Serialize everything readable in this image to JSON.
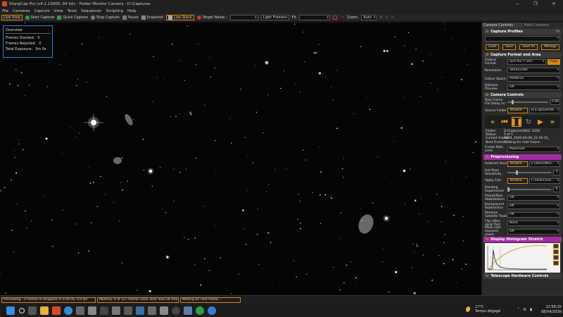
{
  "window": {
    "title": "SharpCap Pro (v4.1.13000, 64 bit) - Folder Monitor Camera - D:\\Captures",
    "controls": [
      "—",
      "❐",
      "✕"
    ]
  },
  "menu": [
    "File",
    "Cameras",
    "Capture",
    "View",
    "Tools",
    "Sequencer",
    "Scripting",
    "Help"
  ],
  "toolbar": {
    "live_view": "Live View",
    "start_capture": "Start Capture",
    "quick_capture": "Quick Capture",
    "stop_capture": "Stop Capture",
    "pause": "Pause",
    "snapshot": "Snapshot",
    "live_stack": "Live Stack",
    "target_name_label": "Target Name :",
    "target_name_value": "",
    "frame_type": "Light Frames",
    "fx_label": "FX",
    "fx_value": "",
    "zoom_label": "Zoom:",
    "zoom_value": "Auto"
  },
  "overview": {
    "title": "Overview",
    "frames_stacked_label": "Frames Stacked:",
    "frames_stacked": "5",
    "frames_rejected_label": "Frames Rejected:",
    "frames_rejected": "0",
    "total_exposure_label": "Total Exposure:",
    "total_exposure": "5m 0s"
  },
  "panel": {
    "tab_active": "Camera Controls",
    "tab_inactive": "Multi Columns",
    "capture_profiles": {
      "title": "Capture Profiles",
      "load": "Load",
      "save": "Save",
      "save_as": "Save As",
      "manage": "Manage"
    },
    "format": {
      "title": "Capture Format and Area",
      "output_format_label": "Output Format",
      "output_format": "SER file (*.ser)",
      "auto": "Auto",
      "resolution_label": "Resolution",
      "resolution": "3856x2180",
      "colour_space_label": "Colour Space",
      "colour_space": "MONO16",
      "debayer_label": "Debayer Preview",
      "debayer": "Off"
    },
    "camera": {
      "title": "Camera Controls",
      "new_frame_label": "New Frame File Delay (s)",
      "new_frame_value": "5.00",
      "source_folder_label": "Source Folder",
      "browse": "Browse...",
      "source_folder": "D:\\Captures\\N...",
      "folder_label": "Folder:",
      "folder": "D:\\Captures\\NGC 3350",
      "status_label": "Status:",
      "status": "5 of 5",
      "current_frame_label": "Current Frame:",
      "current_frame": "0004_2026-04-08_22-56-13_",
      "next_frame_label": "Next Frame:",
      "next_frame": "Waiting for next frame...",
      "frame_rate_label": "Frame Rate Limit",
      "frame_rate": "Maximum"
    },
    "preprocessing": {
      "title": "Preprocessing",
      "subtract_dark_label": "Subtract Dark",
      "browse": "Browse...",
      "subtract_dark": "E:\\darks\\Mini...",
      "hot_pixel_label": "Hot Pixel Sensitivity",
      "hot_pixel": "3",
      "apply_flat_label": "Apply Flat",
      "apply_flat": "C:\\Users\\Trai...",
      "banding_label": "Banding Suppression",
      "banding": "0",
      "planet_label": "Planet/Disk Stabilization",
      "planet": "Off",
      "background_label": "Background Subtraction",
      "background": "Off",
      "satellite_label": "Remove Satellite Trails",
      "satellite": "Off",
      "flip_label": "Flip (after dark/ flat)",
      "flip": "None",
      "mask_label": "Mask over exposed pixels",
      "mask": "Off"
    },
    "histogram": {
      "title": "Display Histogram Stretch"
    },
    "telescope": {
      "title": "Telescope Hardware Controls"
    }
  },
  "status": {
    "previewing": "Previewing : 5 frames (0 dropped) in 0:04:56, 0.0 fps",
    "memory": "Memory: 4 of 127 frames used, Disk: 834 GB free",
    "waiting": "Waiting for next frame..."
  },
  "taskbar": {
    "temperature": "17°C",
    "weather": "Temps dégagé",
    "time": "22:58:20",
    "date": "08/04/2026"
  }
}
